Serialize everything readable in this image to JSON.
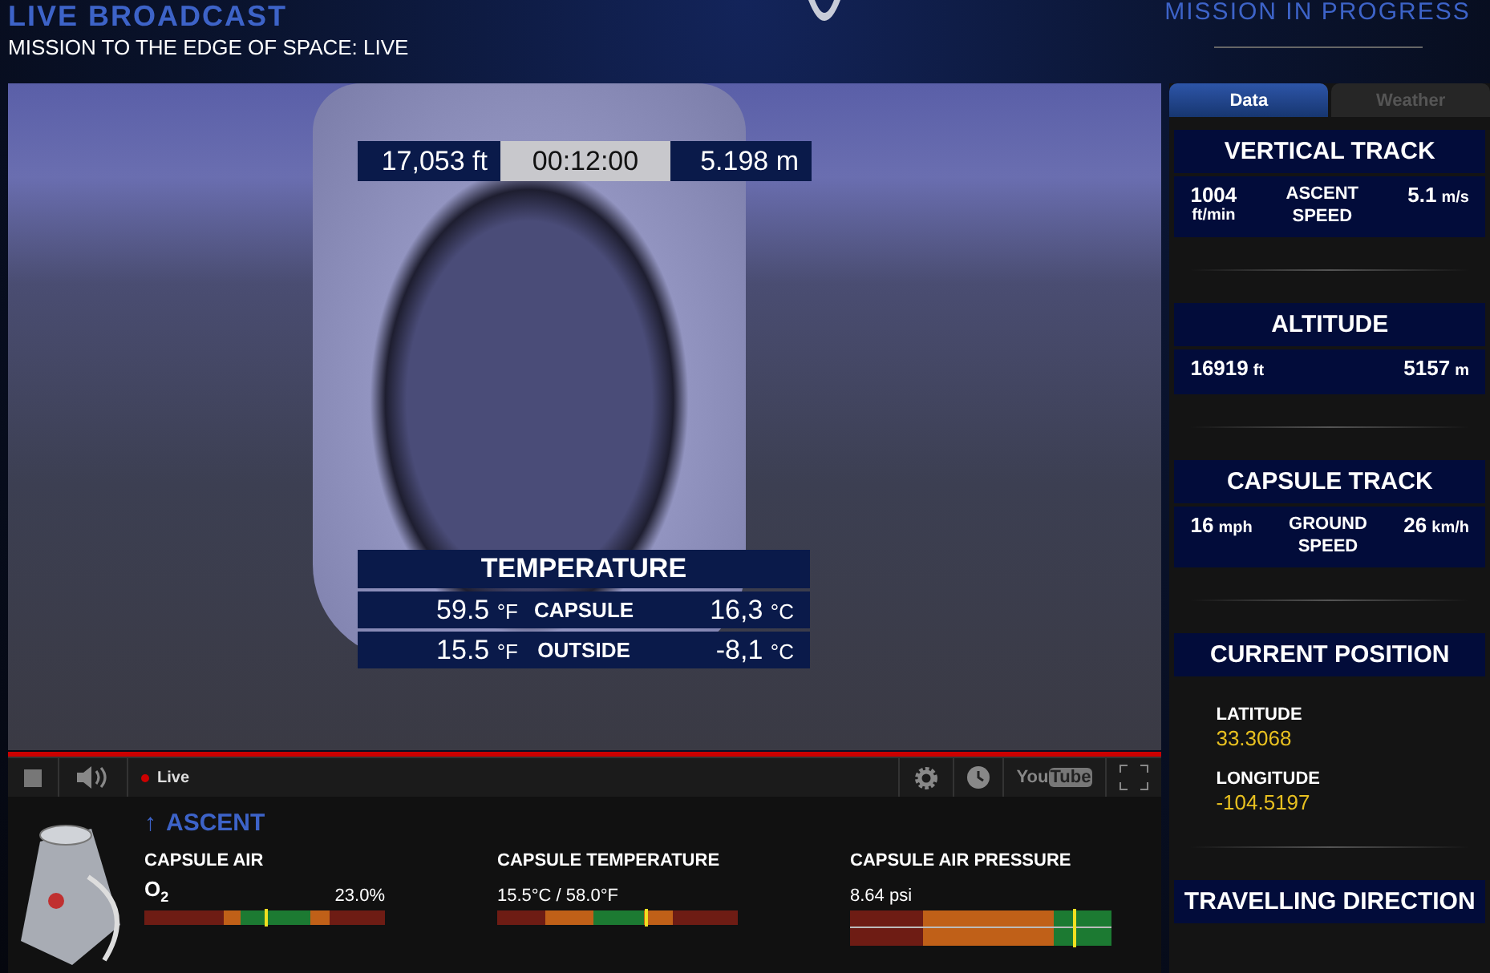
{
  "header": {
    "title": "LIVE BROADCAST",
    "subtitle": "MISSION TO THE EDGE OF SPACE: LIVE",
    "status": "MISSION IN PROGRESS"
  },
  "video": {
    "readout": {
      "left": "17,053 ft",
      "timer": "00:12:00",
      "right": "5.198 m"
    },
    "temperature": {
      "title": "TEMPERATURE",
      "rows": [
        {
          "f_value": "59.5",
          "f_unit": "°F",
          "label": "CAPSULE",
          "c_value": "16,3",
          "c_unit": "°C"
        },
        {
          "f_value": "15.5",
          "f_unit": "°F",
          "label": "OUTSIDE",
          "c_value": "-8,1",
          "c_unit": "°C"
        }
      ]
    },
    "progress": {
      "level": 1
    },
    "controls": {
      "live": "Live",
      "logo_a": "You",
      "logo_b": "Tube"
    }
  },
  "telemetry": {
    "phase_icon": "↑",
    "phase": "ASCENT",
    "gauges": [
      {
        "kind": "o2",
        "title": "CAPSULE AIR",
        "symbol": "O$_{2}$",
        "reading": "23.0%",
        "level": 0.5
      },
      {
        "kind": "temp",
        "title": "CAPSULE TEMPERATURE",
        "reading": "15.5°C / 58.0°F",
        "level": 0.61
      },
      {
        "kind": "pressure",
        "title": "CAPSULE AIR PRESSURE",
        "reading": "8.64 psi",
        "level": 0.85
      }
    ]
  },
  "sidebar": {
    "tabs": [
      {
        "label": "Data",
        "selected": true
      },
      {
        "label": "Weather",
        "selected": false
      }
    ],
    "sections": [
      {
        "kind": "readout",
        "title": "VERTICAL TRACK",
        "left": {
          "value": "1004",
          "unit": "ft/min",
          "stacked": true
        },
        "middle": "ASCENT SPEED",
        "right": {
          "value": "5.1",
          "unit": "m/s",
          "stacked": false
        }
      },
      {
        "kind": "readout",
        "title": "ALTITUDE",
        "left": {
          "value": "16919",
          "unit": "ft",
          "stacked": false
        },
        "right": {
          "value": "5157",
          "unit": "m",
          "stacked": false
        }
      },
      {
        "kind": "readout",
        "title": "CAPSULE TRACK",
        "left": {
          "value": "16",
          "unit": "mph",
          "stacked": false
        },
        "middle": "GROUND SPEED",
        "right": {
          "value": "26",
          "unit": "km/h",
          "stacked": false
        }
      },
      {
        "kind": "position",
        "title": "CURRENT POSITION",
        "items": [
          {
            "label": "LATITUDE",
            "value": "33.3068"
          },
          {
            "label": "LONGITUDE",
            "value": "-104.5197"
          }
        ]
      },
      {
        "kind": "title",
        "title": "TRAVELLING DIRECTION"
      }
    ]
  }
}
